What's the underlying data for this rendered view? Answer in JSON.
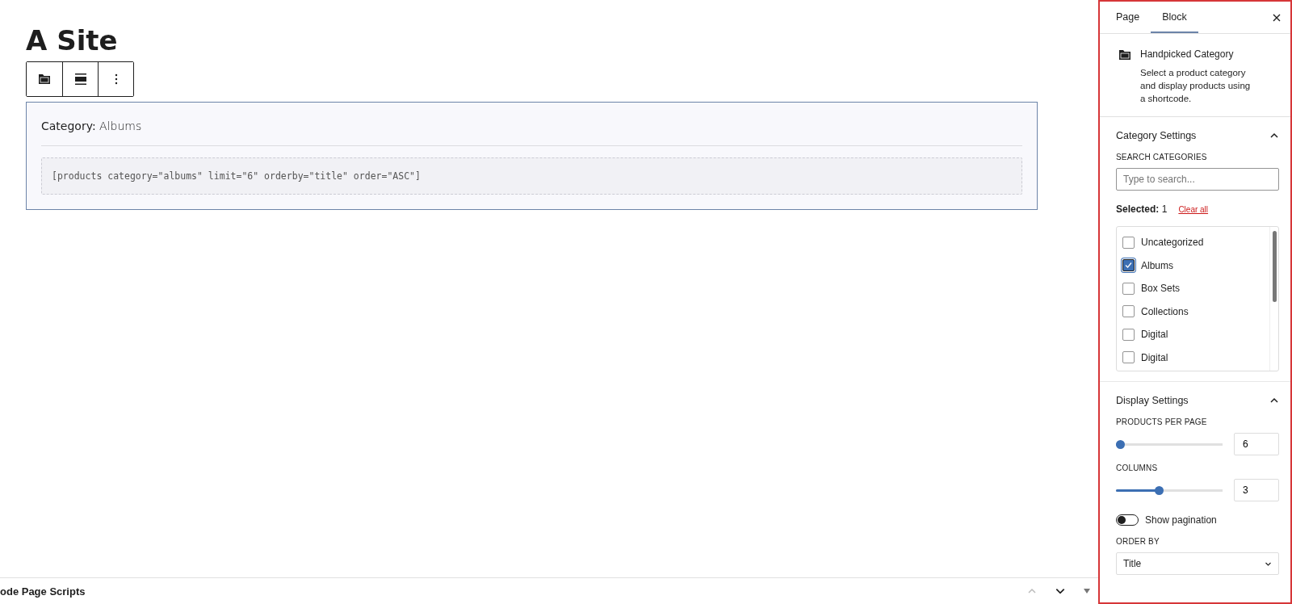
{
  "canvas": {
    "heading": "A Site",
    "block": {
      "caption": "**Category:** Albums",
      "shortcode": "[products category=\"albums\" limit=\"6\" orderby=\"title\" order=\"ASC\"]"
    }
  },
  "footer": {
    "title": "ode Page Scripts"
  },
  "sidebar": {
    "tabs": [
      {
        "label": "Page",
        "selected": false
      },
      {
        "label": "Block",
        "selected": true
      }
    ],
    "block_card": {
      "title": "Handpicked Category",
      "description": "Select a product category and display products using a shortcode."
    },
    "category_settings": {
      "title": "Category Settings",
      "expanded": true,
      "search_label": "SEARCH CATEGORIES",
      "search_placeholder": "Type to search...",
      "selected_text": "**Selected:** 1",
      "clear_link": "Clear all",
      "categories": [
        {
          "label": "Uncategorized",
          "checked": false
        },
        {
          "label": "Albums",
          "checked": true
        },
        {
          "label": "Box Sets",
          "checked": false
        },
        {
          "label": "Collections",
          "checked": false
        },
        {
          "label": "Digital",
          "checked": false
        },
        {
          "label": "Digital",
          "checked": false
        }
      ]
    },
    "display_settings": {
      "title": "Display Settings",
      "expanded": true,
      "sliders": [
        {
          "label": "PRODUCTS PER PAGE",
          "level": 0,
          "value": "6"
        },
        {
          "label": "COLUMNS",
          "level": 0.4,
          "value": "3"
        }
      ],
      "pagination": {
        "label": "Show pagination",
        "on": false
      },
      "order_by": {
        "label": "ORDER BY",
        "value": "Title"
      }
    }
  }
}
